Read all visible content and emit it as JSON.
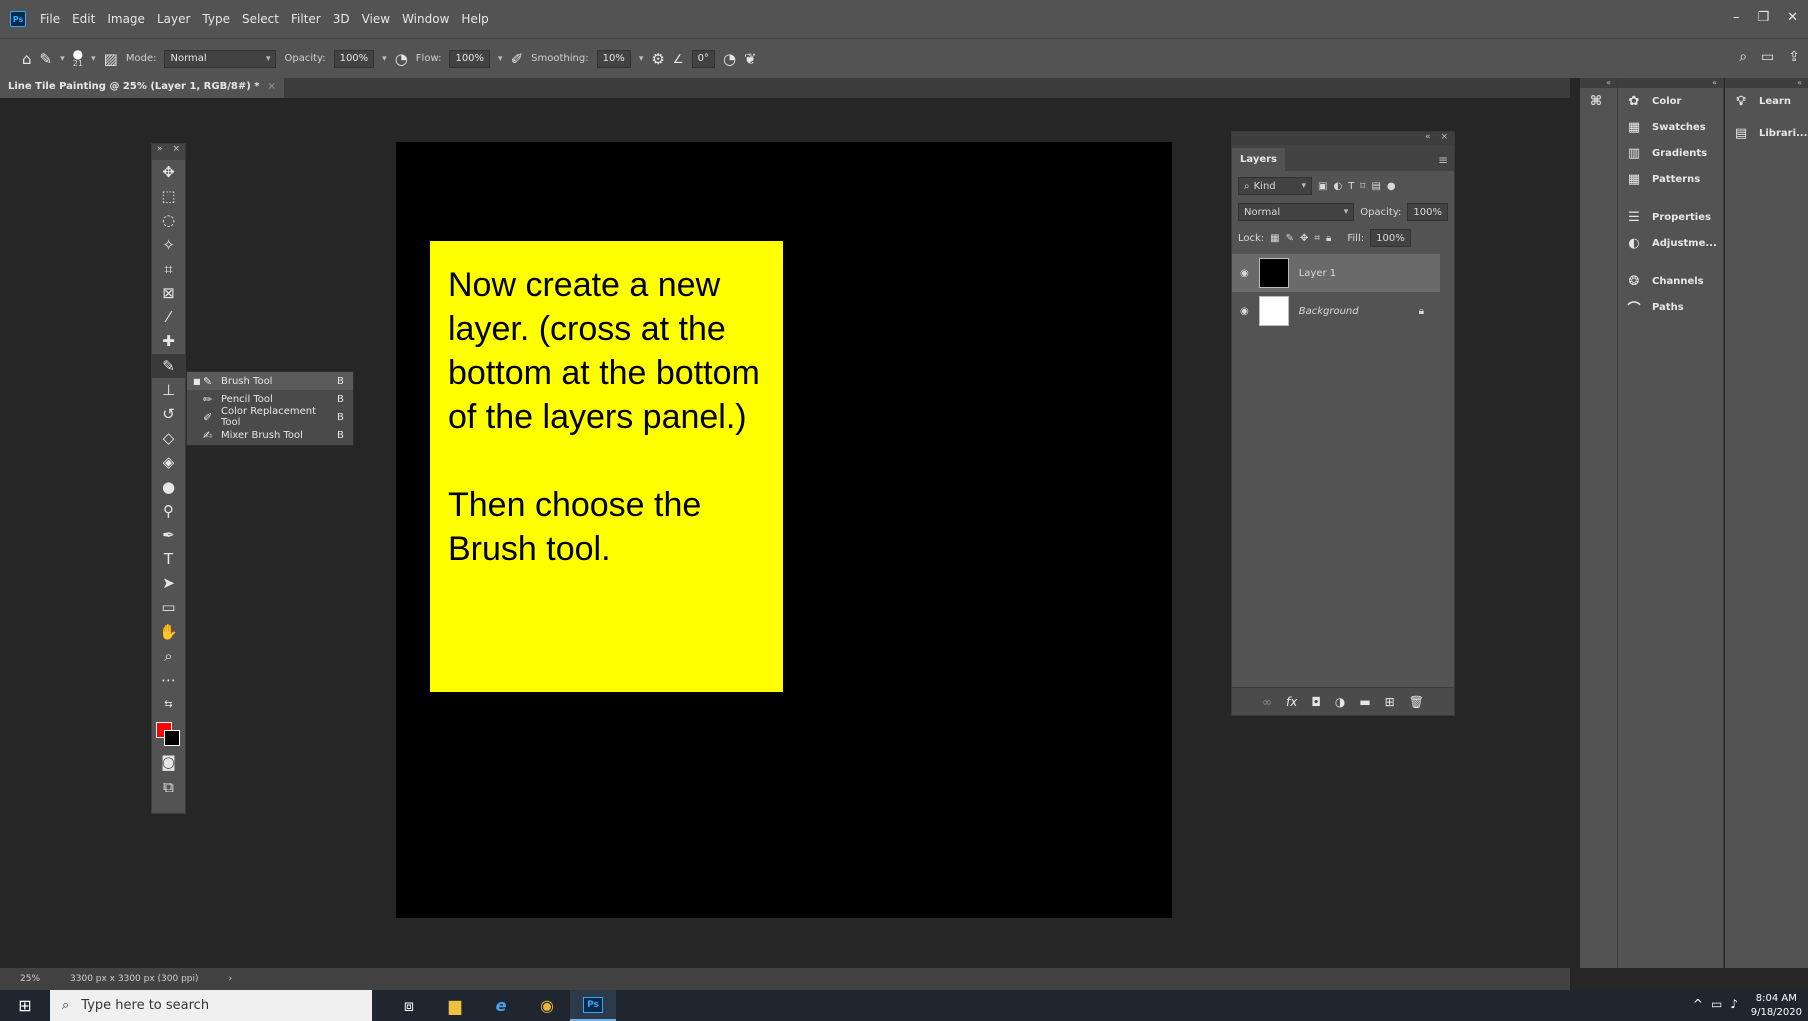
{
  "app": {
    "logo": "Ps",
    "menu": [
      "File",
      "Edit",
      "Image",
      "Layer",
      "Type",
      "Select",
      "Filter",
      "3D",
      "View",
      "Window",
      "Help"
    ]
  },
  "window_controls": {
    "minimize": "–",
    "restore": "❐",
    "close": "✕"
  },
  "options": {
    "brush_size": "21",
    "mode_label": "Mode:",
    "mode_value": "Normal",
    "opacity_label": "Opacity:",
    "opacity_value": "100%",
    "flow_label": "Flow:",
    "flow_value": "100%",
    "smoothing_label": "Smoothing:",
    "smoothing_value": "10%",
    "angle_value": "0°"
  },
  "document_tab": {
    "title": "Line Tile Painting @ 25% (Layer 1, RGB/8#) *",
    "close": "×"
  },
  "note": {
    "line1": "Now create a new layer.  (cross at the bottom at the bottom of the layers panel.)",
    "line2": "Then choose the Brush tool."
  },
  "flyout": {
    "items": [
      {
        "label": "Brush Tool",
        "key": "B",
        "icon": "brush-icon"
      },
      {
        "label": "Pencil Tool",
        "key": "B",
        "icon": "pencil-icon"
      },
      {
        "label": "Color Replacement Tool",
        "key": "B",
        "icon": "color-replacement-icon"
      },
      {
        "label": "Mixer Brush Tool",
        "key": "B",
        "icon": "mixer-brush-icon"
      }
    ]
  },
  "colors": {
    "foreground": "#ff0000",
    "background": "#000000",
    "note": "#ffff00"
  },
  "layers_panel": {
    "tab": "Layers",
    "kind_label": "Kind",
    "blend_mode": "Normal",
    "opacity_label": "Opacity:",
    "opacity_value": "100%",
    "lock_label": "Lock:",
    "fill_label": "Fill:",
    "fill_value": "100%",
    "layers": [
      {
        "name": "Layer 1",
        "selected": true
      },
      {
        "name": "Background",
        "selected": false,
        "locked": true
      }
    ]
  },
  "dock1": [
    "Color",
    "Swatches",
    "Gradients",
    "Patterns",
    "Properties",
    "Adjustme...",
    "Channels",
    "Paths"
  ],
  "dock2": [
    "Learn",
    "Librari..."
  ],
  "status": {
    "zoom": "25%",
    "size": "3300 px x 3300 px (300 ppi)"
  },
  "taskbar": {
    "search_placeholder": "Type here to search",
    "time": "8:04 AM",
    "date": "9/18/2020"
  }
}
